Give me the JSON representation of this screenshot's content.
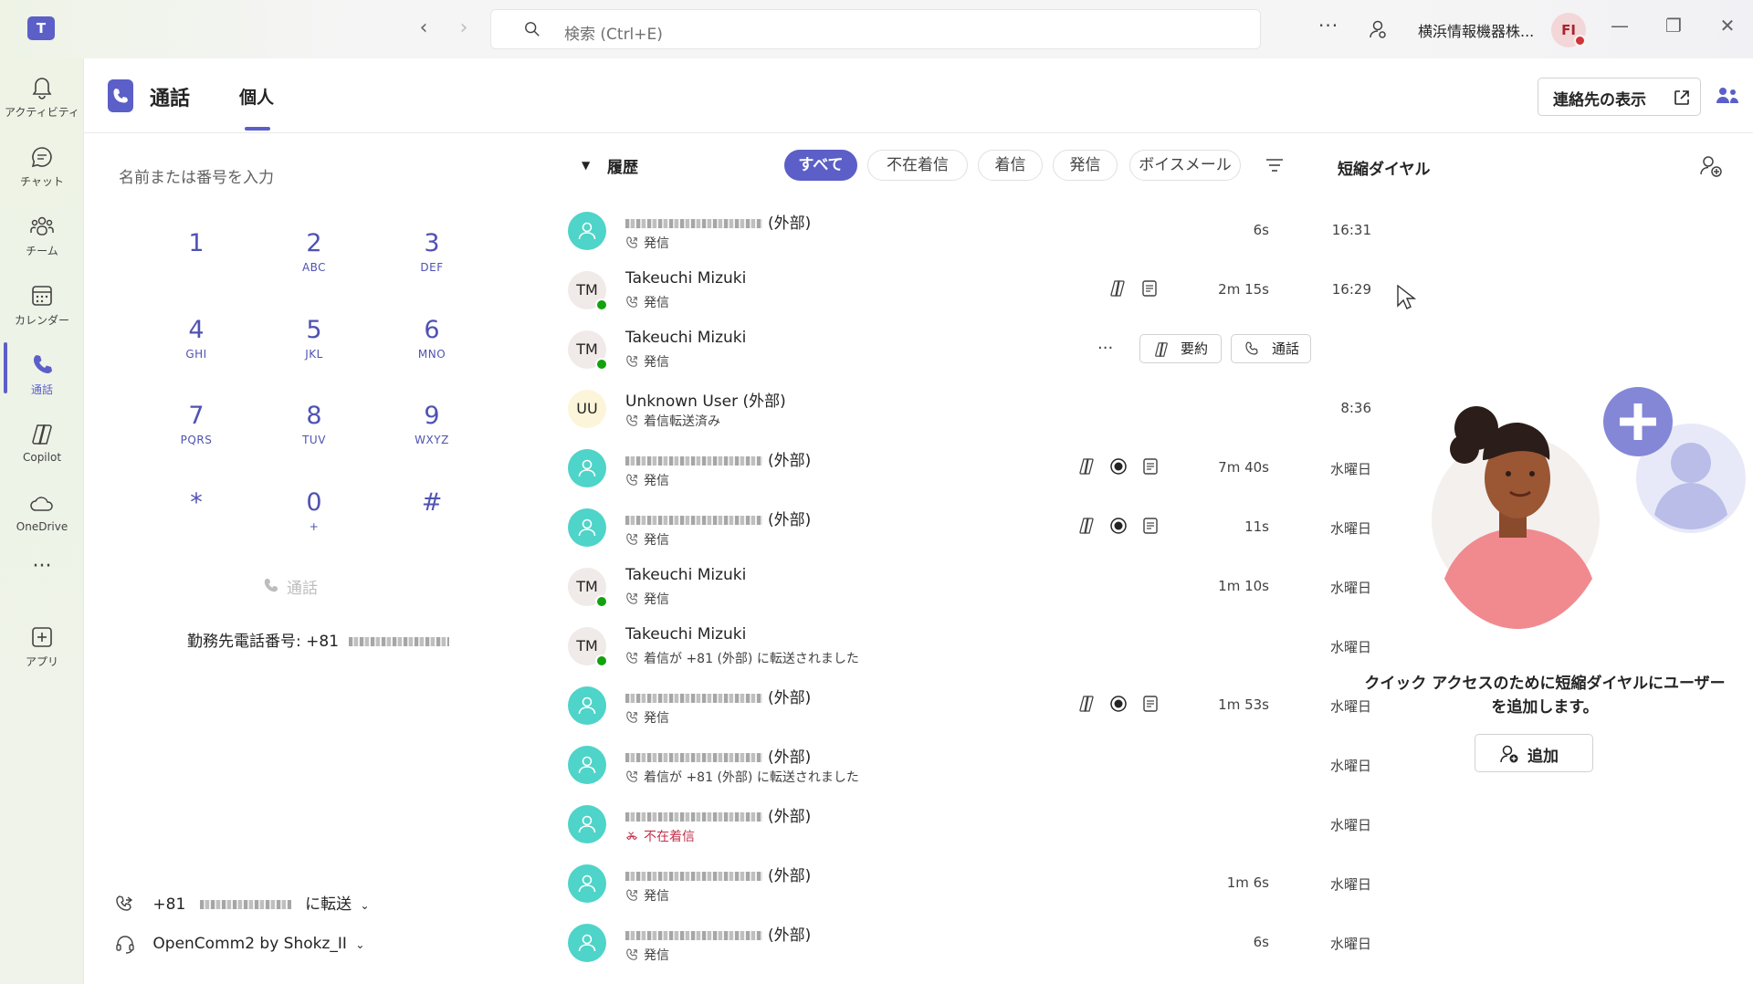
{
  "titlebar": {
    "logo": "T",
    "search_placeholder": "検索 (Ctrl+E)",
    "more": "···",
    "org_name": "横浜情報機器株...",
    "avatar_initials": "FI",
    "minimize": "—",
    "maximize": "❐",
    "close": "✕"
  },
  "rail": {
    "items": [
      {
        "label": "アクティビティ",
        "icon": "bell-icon"
      },
      {
        "label": "チャット",
        "icon": "chat-icon"
      },
      {
        "label": "チーム",
        "icon": "teams-icon"
      },
      {
        "label": "カレンダー",
        "icon": "calendar-icon"
      },
      {
        "label": "通話",
        "icon": "phone-icon"
      },
      {
        "label": "Copilot",
        "icon": "copilot-icon"
      },
      {
        "label": "OneDrive",
        "icon": "cloud-icon"
      },
      {
        "label": "アプリ",
        "icon": "add-app-icon"
      }
    ],
    "more": "···"
  },
  "header": {
    "title": "通話",
    "tab": "個人",
    "contacts_button": "連絡先の表示"
  },
  "dialpad": {
    "placeholder": "名前または番号を入力",
    "keys": [
      {
        "num": "1",
        "sub": ""
      },
      {
        "num": "2",
        "sub": "ABC"
      },
      {
        "num": "3",
        "sub": "DEF"
      },
      {
        "num": "4",
        "sub": "GHI"
      },
      {
        "num": "5",
        "sub": "JKL"
      },
      {
        "num": "6",
        "sub": "MNO"
      },
      {
        "num": "7",
        "sub": "PQRS"
      },
      {
        "num": "8",
        "sub": "TUV"
      },
      {
        "num": "9",
        "sub": "WXYZ"
      },
      {
        "num": "*",
        "sub": ""
      },
      {
        "num": "0",
        "sub": "+"
      },
      {
        "num": "#",
        "sub": ""
      }
    ],
    "call_label": "通話",
    "work_phone_label": "勤務先電話番号: +81",
    "forward_prefix": "+81",
    "forward_suffix": "に転送",
    "device": "OpenComm2 by Shokz_II"
  },
  "history": {
    "title": "履歴",
    "filters": [
      "すべて",
      "不在着信",
      "着信",
      "発信",
      "ボイスメール"
    ],
    "active_filter": "すべて",
    "rows": [
      {
        "name": "(外部)",
        "masked": true,
        "avatar": "ext",
        "sub": "発信",
        "duration": "6s",
        "time": "16:31",
        "icons": []
      },
      {
        "name": "Takeuchi Mizuki",
        "masked": false,
        "avatar": "tm",
        "initials": "TM",
        "sub": "発信",
        "duration": "2m 15s",
        "time": "16:29",
        "icons": [
          "copilot",
          "transcript"
        ]
      },
      {
        "name": "Takeuchi Mizuki",
        "masked": false,
        "avatar": "tm",
        "initials": "TM",
        "sub": "発信",
        "duration": "",
        "time": "",
        "icons": [],
        "hover": true,
        "summary_label": "要約",
        "call_label": "通話"
      },
      {
        "name": "Unknown User (外部)",
        "masked": false,
        "avatar": "uu",
        "initials": "UU",
        "sub": "着信転送済み",
        "duration": "",
        "time": "8:36",
        "icons": []
      },
      {
        "name": "(外部)",
        "masked": true,
        "avatar": "ext",
        "sub": "発信",
        "duration": "7m 40s",
        "time": "水曜日",
        "icons": [
          "copilot",
          "record",
          "transcript"
        ]
      },
      {
        "name": "(外部)",
        "masked": true,
        "avatar": "ext",
        "sub": "発信",
        "duration": "11s",
        "time": "水曜日",
        "icons": [
          "copilot",
          "record",
          "transcript"
        ]
      },
      {
        "name": "Takeuchi Mizuki",
        "masked": false,
        "avatar": "tm",
        "initials": "TM",
        "sub": "発信",
        "duration": "1m 10s",
        "time": "水曜日",
        "icons": []
      },
      {
        "name": "Takeuchi Mizuki",
        "masked": false,
        "avatar": "tm",
        "initials": "TM",
        "sub": "着信が +81 (外部) に転送されました",
        "duration": "",
        "time": "水曜日",
        "icons": []
      },
      {
        "name": "(外部)",
        "masked": true,
        "avatar": "ext",
        "sub": "発信",
        "duration": "1m 53s",
        "time": "水曜日",
        "icons": [
          "copilot",
          "record",
          "transcript"
        ]
      },
      {
        "name": "(外部)",
        "masked": true,
        "avatar": "ext",
        "sub": "着信が +81 (外部) に転送されました",
        "duration": "",
        "time": "水曜日",
        "icons": []
      },
      {
        "name": "(外部)",
        "masked": true,
        "avatar": "ext",
        "sub": "不在着信",
        "missed": true,
        "duration": "",
        "time": "水曜日",
        "icons": []
      },
      {
        "name": "(外部)",
        "masked": true,
        "avatar": "ext",
        "sub": "発信",
        "duration": "1m 6s",
        "time": "水曜日",
        "icons": []
      },
      {
        "name": "(外部)",
        "masked": true,
        "avatar": "ext",
        "sub": "発信",
        "duration": "6s",
        "time": "水曜日",
        "icons": []
      }
    ]
  },
  "speed_dial": {
    "title": "短縮ダイヤル",
    "message": "クイック アクセスのために短縮ダイヤルにユーザーを追加します。",
    "add_button": "追加"
  },
  "colors": {
    "accent": "#5b5fc7",
    "presence_available": "#13a10e",
    "missed": "#c4314b"
  }
}
